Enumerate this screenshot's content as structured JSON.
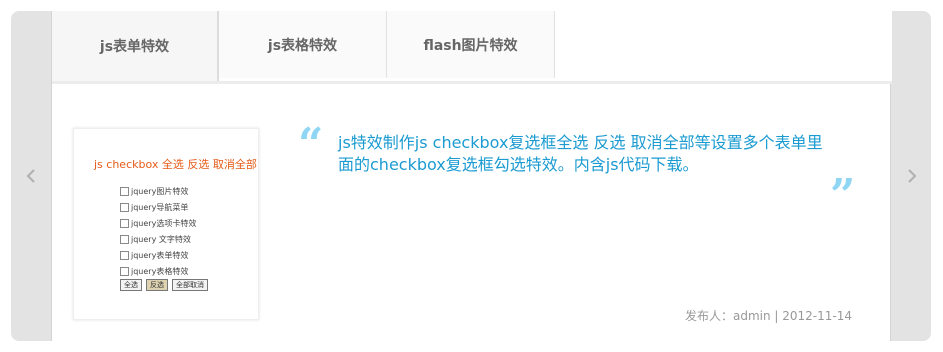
{
  "tabs": [
    {
      "label": "js表单特效",
      "active": true
    },
    {
      "label": "js表格特效",
      "active": false
    },
    {
      "label": "flash图片特效",
      "active": false
    }
  ],
  "nav": {
    "prev_icon": "chevron-left-icon",
    "next_icon": "chevron-right-icon"
  },
  "thumbnail": {
    "title": "js checkbox 全选 反选 取消全部",
    "items": [
      "jquery图片特效",
      "jquery导航菜单",
      "jquery选项卡特效",
      "jquery 文字特效",
      "jquery表单特效",
      "jquery表格特效"
    ],
    "buttons": [
      "全选",
      "反选",
      "全部取消"
    ]
  },
  "slide": {
    "open_quote": "“",
    "close_quote": "”",
    "description": "js特效制作js checkbox复选框全选 反选 取消全部等设置多个表单里面的checkbox复选框勾选特效。内含js代码下载。",
    "meta": "发布人：admin | 2012-11-14"
  },
  "colors": {
    "accent": "#1b9bd1",
    "quote": "#8fd6f4",
    "frame": "#e3e3e3",
    "thumb_title": "#e65a17"
  }
}
